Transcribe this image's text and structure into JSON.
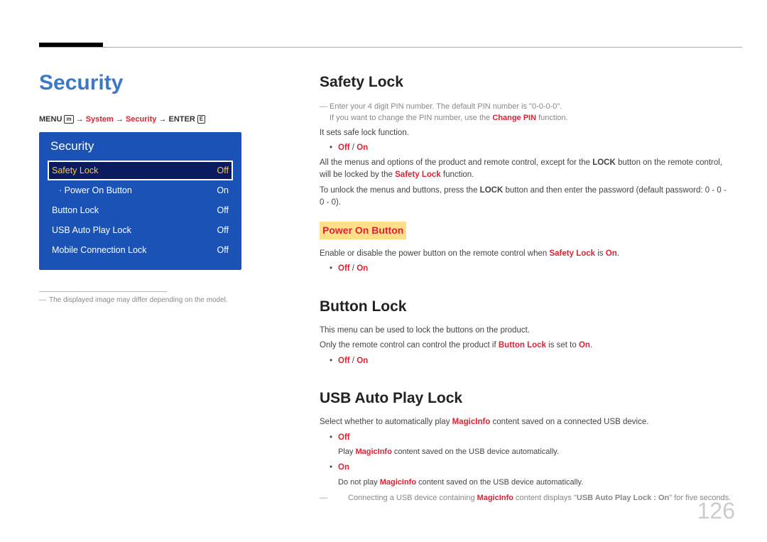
{
  "page_title": "Security",
  "breadcrumb": {
    "menu": "MENU",
    "system": "System",
    "security": "Security",
    "enter": "ENTER"
  },
  "osd": {
    "title": "Security",
    "items": [
      {
        "label": "Safety Lock",
        "value": "Off",
        "selected": true
      },
      {
        "label": "Power On Button",
        "value": "On",
        "sub": true
      },
      {
        "label": "Button Lock",
        "value": "Off"
      },
      {
        "label": "USB Auto Play Lock",
        "value": "Off"
      },
      {
        "label": "Mobile Connection Lock",
        "value": "Off"
      }
    ]
  },
  "caption_note": "The displayed image may differ depending on the model.",
  "safety_lock": {
    "heading": "Safety Lock",
    "note1_a": "Enter your 4 digit PIN number. The default PIN number is \"0-0-0-0\".",
    "note1_b_pre": "If you want to change the PIN number, use the ",
    "note1_b_bold": "Change PIN",
    "note1_b_post": " function.",
    "para1": "It sets safe lock function.",
    "bullet1_off": "Off",
    "bullet1_sep": " / ",
    "bullet1_on": "On",
    "para2_a": "All the menus and options of the product and remote control, except for the ",
    "para2_lock": "LOCK",
    "para2_b": " button on the remote control, will be locked by the ",
    "para2_sl": "Safety Lock",
    "para2_c": " function.",
    "para3_a": "To unlock the menus and buttons, press the ",
    "para3_lock": "LOCK",
    "para3_b": " button and then enter the password (default password: 0 - 0 - 0 - 0)."
  },
  "power_on": {
    "heading": "Power On Button",
    "para_a": "Enable or disable the power button on the remote control when ",
    "para_sl": "Safety Lock",
    "para_b": " is ",
    "para_on": "On",
    "para_c": ".",
    "bullet_off": "Off",
    "bullet_sep": " / ",
    "bullet_on": "On"
  },
  "button_lock": {
    "heading": "Button Lock",
    "para1": "This menu can be used to lock the buttons on the product.",
    "para2_a": "Only the remote control can control the product if ",
    "para2_bl": "Button Lock",
    "para2_b": " is set to ",
    "para2_on": "On",
    "para2_c": ".",
    "bullet_off": "Off",
    "bullet_sep": " / ",
    "bullet_on": "On"
  },
  "usb": {
    "heading": "USB Auto Play Lock",
    "para_a": "Select whether to automatically play ",
    "para_mi": "MagicInfo",
    "para_b": " content saved on a connected USB device.",
    "off_label": "Off",
    "off_desc_a": "Play ",
    "off_desc_mi": "MagicInfo",
    "off_desc_b": " content saved on the USB device automatically.",
    "on_label": "On",
    "on_desc_a": "Do not play ",
    "on_desc_mi": "MagicInfo",
    "on_desc_b": " content saved on the USB device automatically.",
    "note_a": "Connecting a USB device containing ",
    "note_mi": "MagicInfo",
    "note_b": " content displays \"",
    "note_lbl": "USB Auto Play Lock : On",
    "note_c": "\" for five seconds."
  },
  "page_number": "126"
}
